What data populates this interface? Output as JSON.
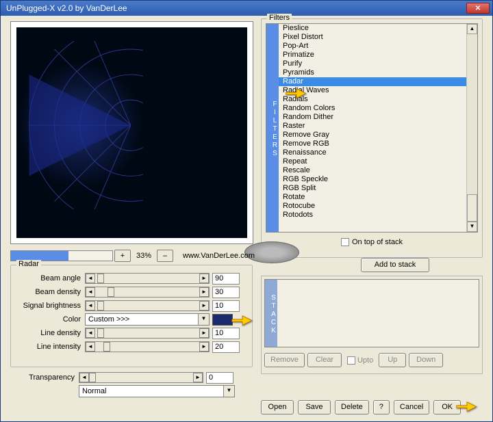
{
  "window": {
    "title": "UnPlugged-X v2.0 by VanDerLee"
  },
  "filters": {
    "label": "Filters",
    "tabLabel": "FILTERS",
    "items": [
      "Pieslice",
      "Pixel Distort",
      "Pop-Art",
      "Primatize",
      "Purify",
      "Pyramids",
      "Radar",
      "Radial Waves",
      "Radials",
      "Random Colors",
      "Random Dither",
      "Raster",
      "Remove Gray",
      "Remove RGB",
      "Renaissance",
      "Repeat",
      "Rescale",
      "RGB Speckle",
      "RGB Split",
      "Rotate",
      "Rotocube",
      "Rotodots"
    ],
    "selectedIndex": 6,
    "onTopLabel": "On top of stack"
  },
  "zoom": {
    "plus": "+",
    "percent": "33%",
    "minus": "–",
    "url": "www.VanDerLee.com"
  },
  "addStackLabel": "Add to stack",
  "radarGroup": {
    "label": "Radar",
    "beamAngle": {
      "label": "Beam angle",
      "value": "90"
    },
    "beamDensity": {
      "label": "Beam density",
      "value": "30"
    },
    "signalBright": {
      "label": "Signal brightness",
      "value": "10"
    },
    "color": {
      "label": "Color",
      "selected": "Custom >>>",
      "swatch": "#1a2a6c"
    },
    "lineDensity": {
      "label": "Line density",
      "value": "10"
    },
    "lineIntensity": {
      "label": "Line intensity",
      "value": "20"
    }
  },
  "transparency": {
    "label": "Transparency",
    "value": "0",
    "mode": "Normal"
  },
  "stack": {
    "tabLabel": "STACK",
    "remove": "Remove",
    "clear": "Clear",
    "upto": "Upto",
    "up": "Up",
    "down": "Down"
  },
  "buttons": {
    "open": "Open",
    "save": "Save",
    "delete": "Delete",
    "help": "?",
    "cancel": "Cancel",
    "ok": "OK"
  }
}
